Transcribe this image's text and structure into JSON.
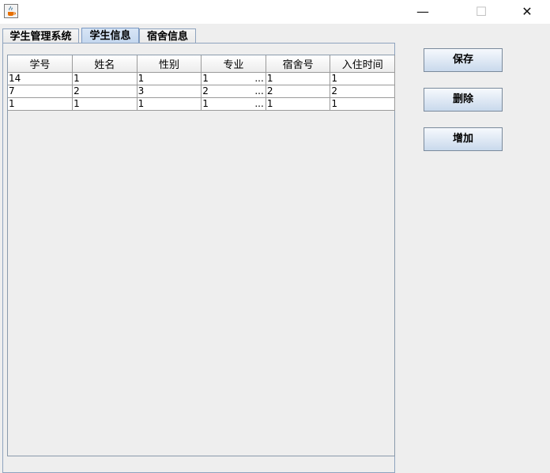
{
  "window": {
    "minimize_glyph": "—",
    "maximize_glyph": "☐",
    "close_glyph": "✕",
    "icon": "java-coffee-cup-icon"
  },
  "tabs": [
    {
      "label": "学生管理系统",
      "selected": false
    },
    {
      "label": "学生信息",
      "selected": true
    },
    {
      "label": "宿舍信息",
      "selected": false
    }
  ],
  "table": {
    "columns": [
      "学号",
      "姓名",
      "性别",
      "专业",
      "宿舍号",
      "入住时间"
    ],
    "rows": [
      [
        "14",
        "1",
        "1",
        "1",
        "1",
        "1"
      ],
      [
        "7",
        "2",
        "3",
        "2",
        "2",
        "2"
      ],
      [
        "1",
        "1",
        "1",
        "1",
        "1",
        "1"
      ]
    ],
    "truncation": "..."
  },
  "buttons": {
    "save": "保存",
    "delete": "删除",
    "add": "增加"
  }
}
